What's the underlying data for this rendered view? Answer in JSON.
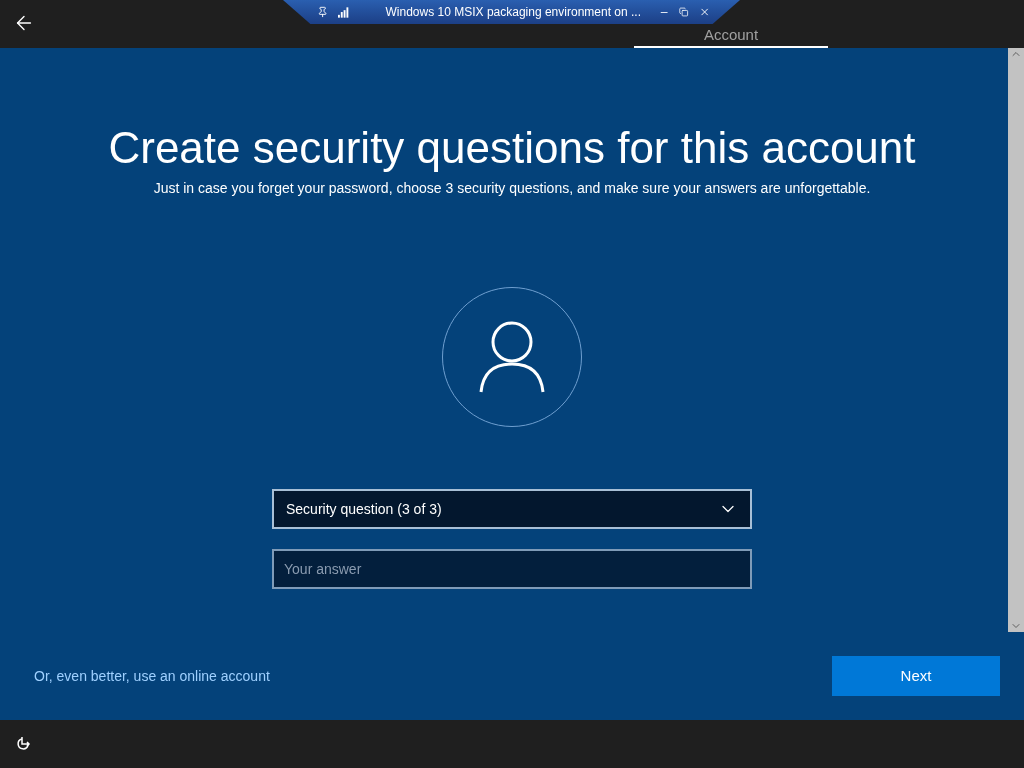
{
  "remote_bar": {
    "title": "Windows 10 MSIX packaging environment on ..."
  },
  "header": {
    "tabs": [
      {
        "label": "Account",
        "selected": true
      }
    ]
  },
  "page": {
    "title": "Create security questions for this account",
    "subtitle": "Just in case you forget your password, choose 3 security questions, and make sure your answers are unforgettable.",
    "question": {
      "value": "Security question (3 of 3)"
    },
    "answer": {
      "placeholder": "Your answer"
    },
    "link": "Or, even better, use an online account",
    "next": "Next"
  }
}
